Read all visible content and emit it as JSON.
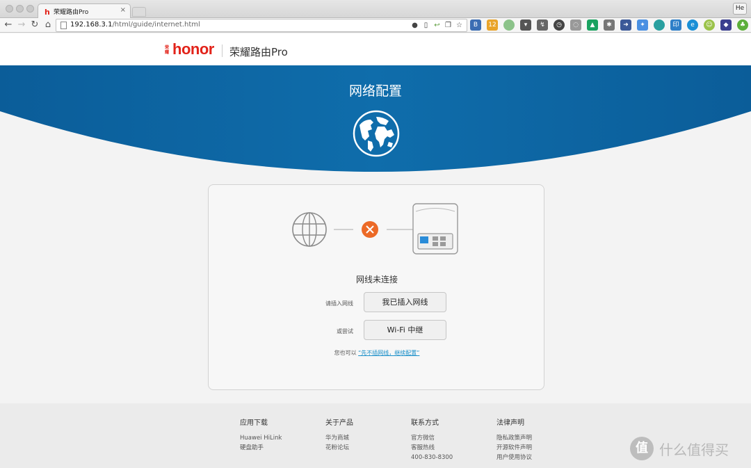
{
  "browser": {
    "tab_title": "荣耀路由Pro",
    "tab_favicon": "h",
    "tab_close": "×",
    "profile_label": "He",
    "url_host": "192.168.3.1",
    "url_path": "/html/guide/internet.html"
  },
  "header": {
    "logo_mark": "荣耀",
    "logo_word": "honor",
    "product_name": "荣耀路由Pro"
  },
  "hero": {
    "title": "网络配置"
  },
  "status": {
    "title": "网线未连接",
    "plug_label": "请插入网线",
    "plug_button": "我已插入网线",
    "try_label": "或尝试",
    "wifi_button": "Wi-Fi 中继",
    "skip_prefix": "您也可以",
    "skip_link": "“先不插网线，继续配置”"
  },
  "footer": {
    "columns": [
      {
        "heading": "应用下载",
        "links": [
          "Huawei HiLink",
          "硬盘助手"
        ]
      },
      {
        "heading": "关于产品",
        "links": [
          "华为商城",
          "花粉论坛"
        ]
      },
      {
        "heading": "联系方式",
        "links": [
          "官方微信",
          "客服热线",
          "400-830-8300"
        ]
      },
      {
        "heading": "法律声明",
        "links": [
          "隐私政策声明",
          "开源软件声明",
          "用户使用协议"
        ]
      }
    ]
  },
  "watermark": {
    "badge": "值",
    "text": "什么值得买"
  },
  "colors": {
    "hero_blue": "#0e6aa8",
    "error_orange": "#ec6a27",
    "brand_red": "#e2231a",
    "link_blue": "#1a8fc9"
  }
}
